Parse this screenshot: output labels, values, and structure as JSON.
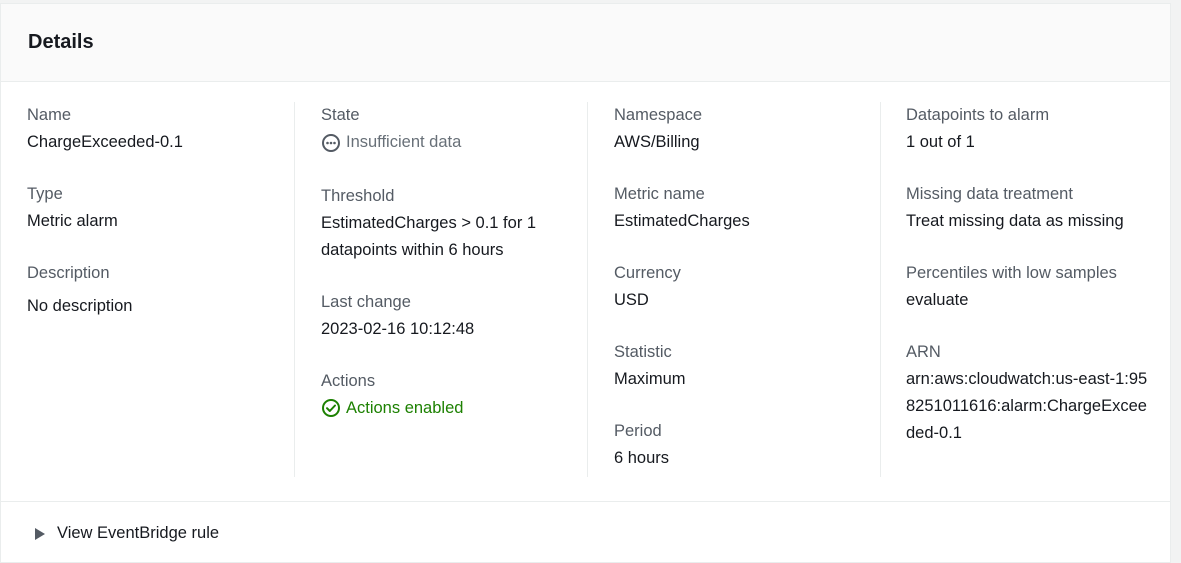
{
  "panel": {
    "title": "Details"
  },
  "fields": {
    "name": {
      "label": "Name",
      "value": "ChargeExceeded-0.1"
    },
    "type": {
      "label": "Type",
      "value": "Metric alarm"
    },
    "description": {
      "label": "Description",
      "value": "No description"
    },
    "state": {
      "label": "State",
      "value": "Insufficient data",
      "icon": "ellipsis-circle-icon"
    },
    "threshold": {
      "label": "Threshold",
      "value": "EstimatedCharges > 0.1 for 1 datapoints within 6 hours"
    },
    "last_change": {
      "label": "Last change",
      "value": "2023-02-16 10:12:48"
    },
    "actions": {
      "label": "Actions",
      "value": "Actions enabled",
      "icon": "check-circle-icon"
    },
    "namespace": {
      "label": "Namespace",
      "value": "AWS/Billing"
    },
    "metric_name": {
      "label": "Metric name",
      "value": "EstimatedCharges"
    },
    "currency": {
      "label": "Currency",
      "value": "USD"
    },
    "statistic": {
      "label": "Statistic",
      "value": "Maximum"
    },
    "period": {
      "label": "Period",
      "value": "6 hours"
    },
    "datapoints": {
      "label": "Datapoints to alarm",
      "value": "1 out of 1"
    },
    "missing_data": {
      "label": "Missing data treatment",
      "value": "Treat missing data as missing"
    },
    "percentiles": {
      "label": "Percentiles with low samples",
      "value": "evaluate"
    },
    "arn": {
      "label": "ARN",
      "value": "arn:aws:cloudwatch:us-east-1:958251011616:alarm:ChargeExceeded-0.1"
    }
  },
  "footer": {
    "expander_label": "View EventBridge rule",
    "icon": "caret-right-icon"
  },
  "colors": {
    "success": "#1d8102",
    "muted": "#687078",
    "label": "#545b64",
    "text": "#16191f"
  }
}
